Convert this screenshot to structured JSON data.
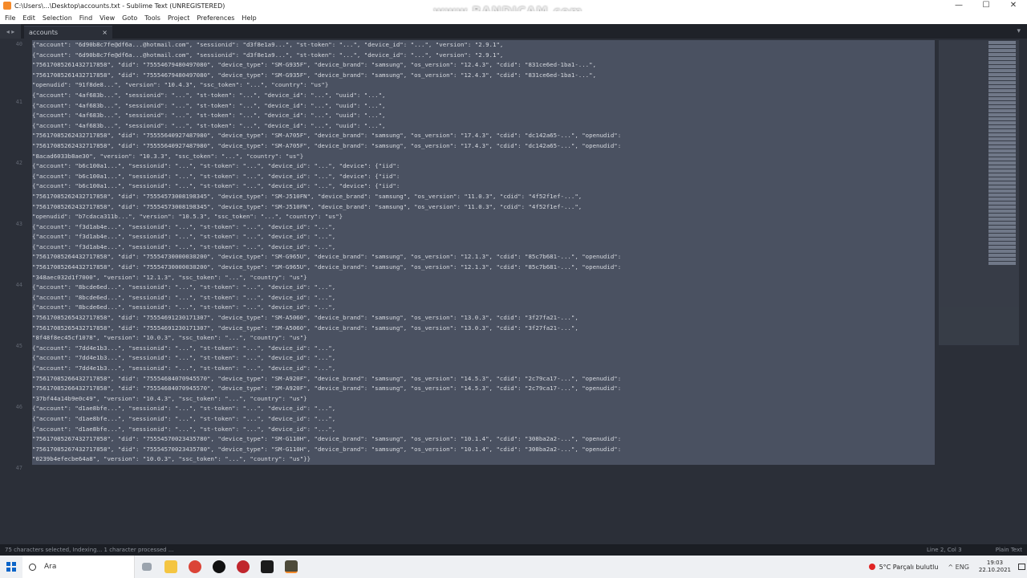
{
  "window": {
    "title": "C:\\Users\\...\\Desktop\\accounts.txt - Sublime Text (UNREGISTERED)",
    "watermark": "www.BANDICAM.com",
    "controls": [
      "—",
      "☐",
      "✕"
    ]
  },
  "menu": [
    "File",
    "Edit",
    "Selection",
    "Find",
    "View",
    "Goto",
    "Tools",
    "Project",
    "Preferences",
    "Help"
  ],
  "tabs": {
    "nav_label": "◂ ▸",
    "active": {
      "label": "accounts",
      "close": "×"
    },
    "dropdown": "▾"
  },
  "editor": {
    "line_numbers": [
      "40",
      "41",
      "42",
      "43",
      "44",
      "45",
      "46",
      "47",
      "48"
    ],
    "lines": [
      "{\"account\": \"6d90b8c7fe@df6a...@hotmail.com\", \"sessionid\": \"d3f8e1a9...\", \"st-token\": \"...\", \"device_id\": \"...\", \"version\": \"2.9.1\",",
      "\"75617085261432717858\", \"did\": \"75554679480497080\", \"device_type\": \"SM-G935F\", \"device_brand\": \"samsung\", \"os_version\": \"12.4.3\", \"cdid\": \"831ce6ed-1ba1-...\",",
      "\"openudid\": \"91f8de8...\", \"version\": \"10.4.3\", \"ssc_token\": \"...\", \"country\": \"us\"}",
      "{\"account\": \"4af683b...\", \"sessionid\": \"...\", \"st-token\": \"...\", \"device_id\": \"...\", \"uuid\": \"...\",",
      "\"75617085262432717858\", \"did\": \"75555640927487980\", \"device_type\": \"SM-A705F\", \"device_brand\": \"samsung\", \"os_version\": \"17.4.3\", \"cdid\": \"dc142a65-...\", \"openudid\":",
      "\"8acad6033b8ae30\", \"version\": \"10.3.3\", \"ssc_token\": \"...\", \"country\": \"us\"}",
      "{\"account\": \"b6c100a1...\", \"sessionid\": \"...\", \"st-token\": \"...\", \"device_id\": \"...\", \"device\": {\"iid\":",
      "\"75617085262432717858\", \"did\": \"75554573008198345\", \"device_type\": \"SM-J510FN\", \"device_brand\": \"samsung\", \"os_version\": \"11.0.3\", \"cdid\": \"4f52f1ef-...\",",
      "\"openudid\": \"b7cdaca311b...\", \"version\": \"10.5.3\", \"ssc_token\": \"...\", \"country\": \"us\"}",
      "{\"account\": \"f3d1ab4e...\", \"sessionid\": \"...\", \"st-token\": \"...\", \"device_id\": \"...\",",
      "\"75617085264432717858\", \"did\": \"75554730000030200\", \"device_type\": \"SM-G965U\", \"device_brand\": \"samsung\", \"os_version\": \"12.1.3\", \"cdid\": \"85c7b681-...\", \"openudid\":",
      "\"348aec032d1f7000\", \"version\": \"12.1.3\", \"ssc_token\": \"...\", \"country\": \"us\"}",
      "{\"account\": \"8bcde6ed...\", \"sessionid\": \"...\", \"st-token\": \"...\", \"device_id\": \"...\",",
      "\"75617085265432717858\", \"did\": \"75554691230171307\", \"device_type\": \"SM-A5060\", \"device_brand\": \"samsung\", \"os_version\": \"13.0.3\", \"cdid\": \"3f27fa21-...\",",
      "\"8f48f8ec45cf1078\", \"version\": \"10.0.3\", \"ssc_token\": \"...\", \"country\": \"us\"}",
      "{\"account\": \"7dd4e1b3...\", \"sessionid\": \"...\", \"st-token\": \"...\", \"device_id\": \"...\",",
      "\"75617085266432717858\", \"did\": \"75554684070945570\", \"device_type\": \"SM-A920F\", \"device_brand\": \"samsung\", \"os_version\": \"14.5.3\", \"cdid\": \"2c79ca17-...\", \"openudid\":",
      "\"37bf44a14b9e0c49\", \"version\": \"10.4.3\", \"ssc_token\": \"...\", \"country\": \"us\"}",
      "{\"account\": \"d1ae8bfe...\", \"sessionid\": \"...\", \"st-token\": \"...\", \"device_id\": \"...\",",
      "\"75617085267432717858\", \"did\": \"75554570023435780\", \"device_type\": \"SM-G110H\", \"device_brand\": \"samsung\", \"os_version\": \"10.1.4\", \"cdid\": \"308ba2a2-...\", \"openudid\":",
      "\"0239b4efecbe64a8\", \"version\": \"10.0.3\", \"ssc_token\": \"...\", \"country\": \"us\"}}"
    ]
  },
  "status": {
    "left": "75 characters selected, Indexing... 1 character processed ...",
    "line_col": "Line 2, Col 3",
    "syntax": "Plain Text"
  },
  "taskbar": {
    "search_placeholder": "Ara",
    "weather": "5°C Parçalı bulutlu",
    "system": "^ ENG",
    "time": "19:03",
    "date": "22.10.2021"
  },
  "colors": {
    "editor_bg": "#2b2f38",
    "selection": "#4a5161",
    "brand_sublime": "#f58a2a",
    "windows_blue": "#0a64c8"
  }
}
